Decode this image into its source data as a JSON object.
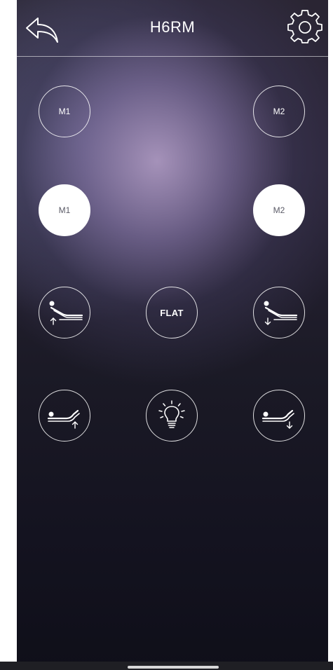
{
  "header": {
    "title": "H6RM",
    "back_icon": "back-arrow-icon",
    "settings_icon": "gear-icon"
  },
  "memory_row_outline": {
    "left_label": "M1",
    "right_label": "M2"
  },
  "memory_row_filled": {
    "left_label": "M1",
    "right_label": "M2"
  },
  "head_row": {
    "left_icon": "head-up-icon",
    "center_label": "FLAT",
    "right_icon": "head-down-icon"
  },
  "foot_row": {
    "left_icon": "foot-up-icon",
    "center_icon": "light-bulb-icon",
    "right_icon": "foot-down-icon"
  },
  "colors": {
    "accent": "#ffffff",
    "background_dark": "#141320",
    "glow": "#a896be"
  }
}
